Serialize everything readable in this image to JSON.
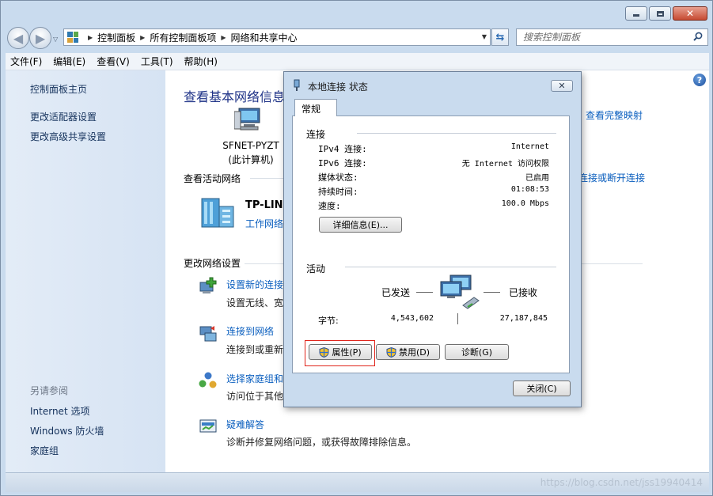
{
  "window": {
    "address": {
      "crumbs": [
        "控制面板",
        "所有控制面板项",
        "网络和共享中心"
      ]
    },
    "search": {
      "placeholder": "搜索控制面板"
    },
    "menu": [
      "文件(F)",
      "编辑(E)",
      "查看(V)",
      "工具(T)",
      "帮助(H)"
    ]
  },
  "sidebar": {
    "links": [
      "控制面板主页",
      "更改适配器设置",
      "更改高级共享设置"
    ],
    "see_also_heading": "另请参阅",
    "see_also": [
      "Internet 选项",
      "Windows 防火墙",
      "家庭组"
    ]
  },
  "main": {
    "title": "查看基本网络信息",
    "full_map": "查看完整映射",
    "computer_name": "SFNET-PYZT",
    "computer_sub": "(此计算机)",
    "active_heading": "查看活动网络",
    "network_name": "TP-LINK",
    "network_type": "工作网络",
    "disconnect": "连接或断开连接",
    "settings_heading": "更改网络设置",
    "tasks": [
      {
        "link": "设置新的连接",
        "desc": "设置无线、宽"
      },
      {
        "link": "连接到网络",
        "desc": "连接到或重新"
      },
      {
        "link": "选择家庭组和",
        "desc": "访问位于其他"
      },
      {
        "link": "疑难解答",
        "desc": "诊断并修复网络问题，或获得故障排除信息。"
      }
    ]
  },
  "statusbar": {
    "watermark": "https://blog.csdn.net/jss19940414"
  },
  "dialog": {
    "title": "本地连接 状态",
    "tab": "常规",
    "connection_heading": "连接",
    "rows": [
      {
        "label": "IPv4 连接:",
        "value": "Internet"
      },
      {
        "label": "IPv6 连接:",
        "value": "无 Internet 访问权限"
      },
      {
        "label": "媒体状态:",
        "value": "已启用"
      },
      {
        "label": "持续时间:",
        "value": "01:08:53"
      },
      {
        "label": "速度:",
        "value": "100.0 Mbps"
      }
    ],
    "details_button": "详细信息(E)...",
    "activity_heading": "活动",
    "sent_label": "已发送",
    "received_label": "已接收",
    "bytes_label": "字节:",
    "bytes_sent": "4,543,602",
    "bytes_received": "27,187,845",
    "properties_button": "属性(P)",
    "disable_button": "禁用(D)",
    "diagnose_button": "诊断(G)",
    "close_button": "关闭(C)"
  }
}
